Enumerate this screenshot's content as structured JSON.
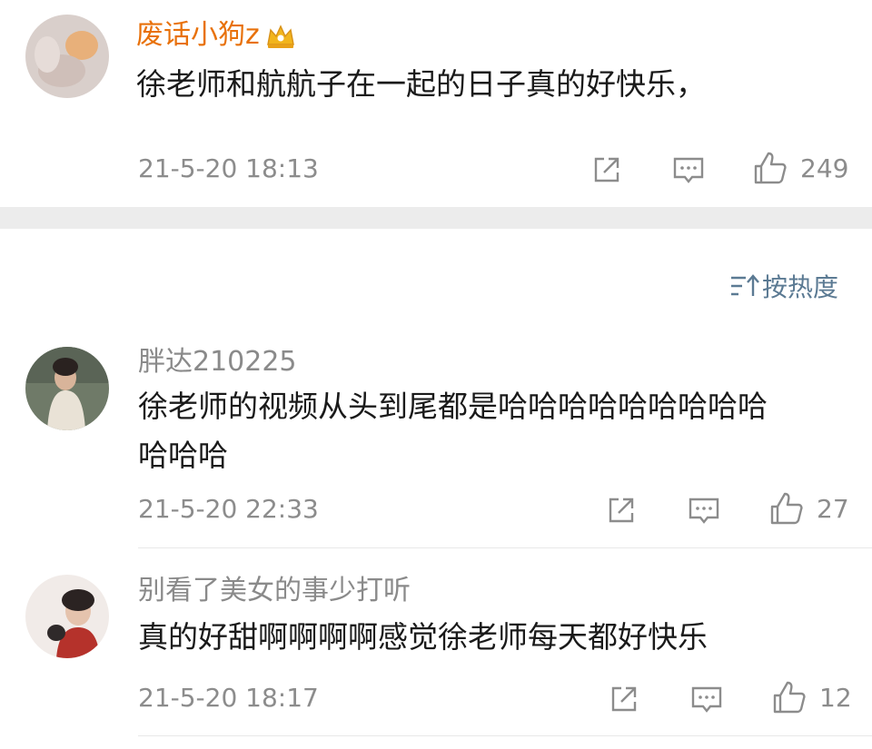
{
  "comments": [
    {
      "user": "废话小狗z",
      "text": "徐老师和航航子在一起的日子真的好快乐，",
      "time": "21-5-20 18:13",
      "likes": "249"
    },
    {
      "user": "胖达210225",
      "text_line1": "徐老师的视频从头到尾都是哈哈哈哈哈哈哈哈哈",
      "text_line2": "哈哈哈",
      "time": "21-5-20 22:33",
      "likes": "27"
    },
    {
      "user": "别看了美女的事少打听",
      "text": "真的好甜啊啊啊啊感觉徐老师每天都好快乐",
      "time": "21-5-20 18:17",
      "likes": "12"
    }
  ],
  "sort": {
    "label": "按热度"
  },
  "colors": {
    "vip_name": "#e8710a",
    "sort_link": "#5b7a93",
    "section_gap": "#ececec"
  }
}
